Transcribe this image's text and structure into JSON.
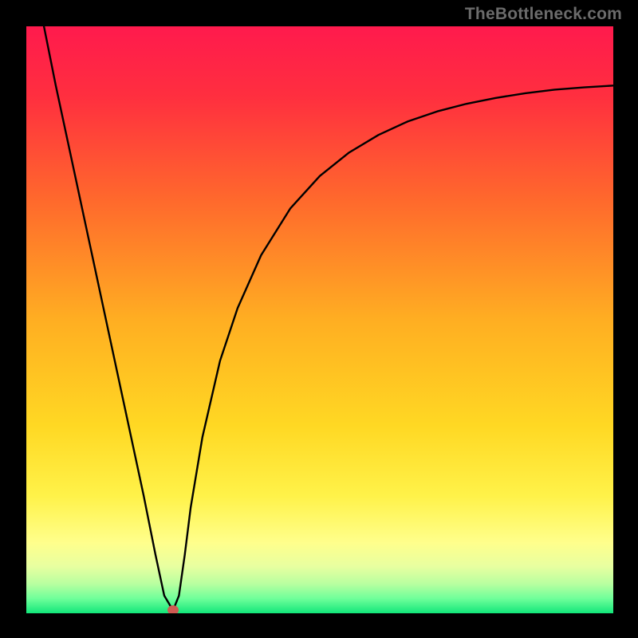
{
  "watermark": "TheBottleneck.com",
  "colors": {
    "curve_stroke": "#000000",
    "dot_fill": "#cf5a52",
    "frame_background": "#000000"
  },
  "chart_data": {
    "type": "line",
    "title": "",
    "xlabel": "",
    "ylabel": "",
    "xlim": [
      0,
      100
    ],
    "ylim": [
      0,
      100
    ],
    "grid": false,
    "legend": false,
    "annotations": [
      "TheBottleneck.com"
    ],
    "series": [
      {
        "name": "bottleneck-curve",
        "x": [
          3,
          5,
          8,
          11,
          14,
          17,
          20,
          22,
          23.5,
          25,
          26,
          27,
          28,
          30,
          33,
          36,
          40,
          45,
          50,
          55,
          60,
          65,
          70,
          75,
          80,
          85,
          90,
          95,
          100
        ],
        "y": [
          100,
          90,
          76,
          62,
          48,
          34,
          20,
          10,
          3,
          0.5,
          3,
          10,
          18,
          30,
          43,
          52,
          61,
          69,
          74.5,
          78.5,
          81.5,
          83.8,
          85.5,
          86.8,
          87.8,
          88.6,
          89.2,
          89.6,
          89.9
        ]
      }
    ],
    "min_point": {
      "x": 25,
      "y": 0.5
    },
    "background_gradient": {
      "orientation": "vertical",
      "stops": [
        {
          "pos": 0.0,
          "color": "#ff1a4d"
        },
        {
          "pos": 0.12,
          "color": "#ff2f3f"
        },
        {
          "pos": 0.3,
          "color": "#ff6a2c"
        },
        {
          "pos": 0.5,
          "color": "#ffae22"
        },
        {
          "pos": 0.68,
          "color": "#ffd823"
        },
        {
          "pos": 0.8,
          "color": "#fff249"
        },
        {
          "pos": 0.88,
          "color": "#ffff8c"
        },
        {
          "pos": 0.92,
          "color": "#e8ffa0"
        },
        {
          "pos": 0.95,
          "color": "#b8ffa0"
        },
        {
          "pos": 0.975,
          "color": "#6fff9a"
        },
        {
          "pos": 1.0,
          "color": "#12e67a"
        }
      ]
    }
  }
}
